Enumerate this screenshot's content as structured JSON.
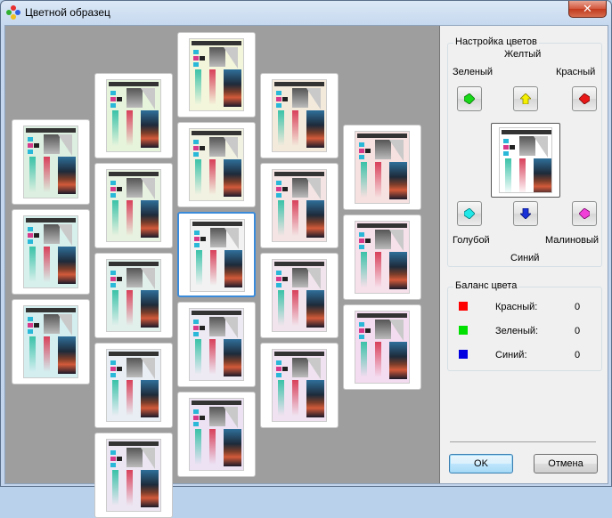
{
  "window": {
    "title": "Цветной образец",
    "close_symbol": "✕"
  },
  "color_setup": {
    "group_label": "Настройка цветов",
    "yellow": "Желтый",
    "green": "Зеленый",
    "red": "Красный",
    "cyan": "Голубой",
    "magenta": "Малиновый",
    "blue": "Синий",
    "colors": {
      "yellow": "#f5f000",
      "green": "#18d818",
      "red": "#e81818",
      "cyan": "#20e8e8",
      "magenta": "#f040d8",
      "blue": "#1830d8"
    }
  },
  "color_balance": {
    "group_label": "Баланс цвета",
    "rows": [
      {
        "label": "Красный:",
        "value": "0",
        "color": "#ff0000"
      },
      {
        "label": "Зеленый:",
        "value": "0",
        "color": "#00e000"
      },
      {
        "label": "Синий:",
        "value": "0",
        "color": "#0000e0"
      }
    ]
  },
  "buttons": {
    "ok": "OK",
    "cancel": "Отмена"
  },
  "thumbnails": [
    {
      "id": "t-c0-0",
      "tint": "#dcefe0"
    },
    {
      "id": "t-c0-1",
      "tint": "#d8f0ec"
    },
    {
      "id": "t-c0-2",
      "tint": "#d4eef0"
    },
    {
      "id": "t-c1-0",
      "tint": "#e6f4dc"
    },
    {
      "id": "t-c1-1",
      "tint": "#e8f2e0"
    },
    {
      "id": "t-c1-2",
      "tint": "#e2f0ec"
    },
    {
      "id": "t-c1-3",
      "tint": "#e8eef4"
    },
    {
      "id": "t-c1-4",
      "tint": "#ece6f2"
    },
    {
      "id": "t-c2-0",
      "tint": "#f4f6dc"
    },
    {
      "id": "t-c2-1",
      "tint": "#f2f2e2"
    },
    {
      "id": "t-c2-2",
      "tint": "#f2f2f2",
      "selected": true
    },
    {
      "id": "t-c2-3",
      "tint": "#eeeaf4"
    },
    {
      "id": "t-c2-4",
      "tint": "#ece2f4"
    },
    {
      "id": "t-c3-0",
      "tint": "#f4eadc"
    },
    {
      "id": "t-c3-1",
      "tint": "#f4e4e4"
    },
    {
      "id": "t-c3-2",
      "tint": "#f2e4ec"
    },
    {
      "id": "t-c3-3",
      "tint": "#f0e2f0"
    },
    {
      "id": "t-c4-0",
      "tint": "#f6e0e0"
    },
    {
      "id": "t-c4-1",
      "tint": "#f6e0ea"
    },
    {
      "id": "t-c4-2",
      "tint": "#f4dcf0"
    }
  ]
}
